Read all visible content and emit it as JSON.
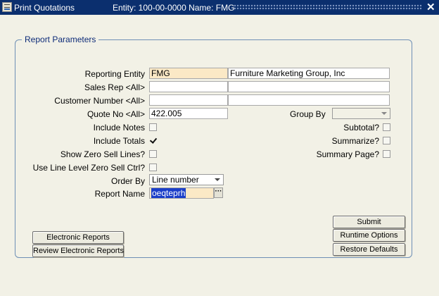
{
  "window": {
    "title": "Print Quotations",
    "entity_info": "Entity: 100-00-0000  Name: FMG",
    "close_glyph": "✕"
  },
  "group": {
    "legend": "Report Parameters"
  },
  "form": {
    "reporting_entity": {
      "label": "Reporting Entity",
      "code": "FMG",
      "name": "Furniture Marketing Group, Inc"
    },
    "sales_rep": {
      "label": "Sales Rep <All>",
      "code": "",
      "name": ""
    },
    "customer_number": {
      "label": "Customer Number <All>",
      "code": "",
      "name": ""
    },
    "quote_no": {
      "label": "Quote No <All>",
      "value": "422.005"
    },
    "group_by": {
      "label": "Group By",
      "value": ""
    },
    "include_notes": {
      "label": "Include Notes",
      "checked": false
    },
    "include_totals": {
      "label": "Include Totals",
      "checked": true
    },
    "show_zero_sell_lines": {
      "label": "Show Zero Sell Lines?",
      "checked": false
    },
    "use_line_level_zero_sell_ctrl": {
      "label": "Use Line Level Zero Sell Ctrl?",
      "checked": false
    },
    "subtotal": {
      "label": "Subtotal?",
      "checked": false
    },
    "summarize": {
      "label": "Summarize?",
      "checked": false
    },
    "summary_page": {
      "label": "Summary Page?",
      "checked": false
    },
    "order_by": {
      "label": "Order By",
      "value": "Line number"
    },
    "report_name": {
      "label": "Report Name",
      "value": "oeqteprh",
      "lov_glyph": "···"
    }
  },
  "buttons": {
    "electronic_reports": "Electronic Reports",
    "review_electronic_reports": "Review Electronic Reports",
    "submit": "Submit",
    "runtime_options": "Runtime Options",
    "restore_defaults": "Restore Defaults"
  }
}
